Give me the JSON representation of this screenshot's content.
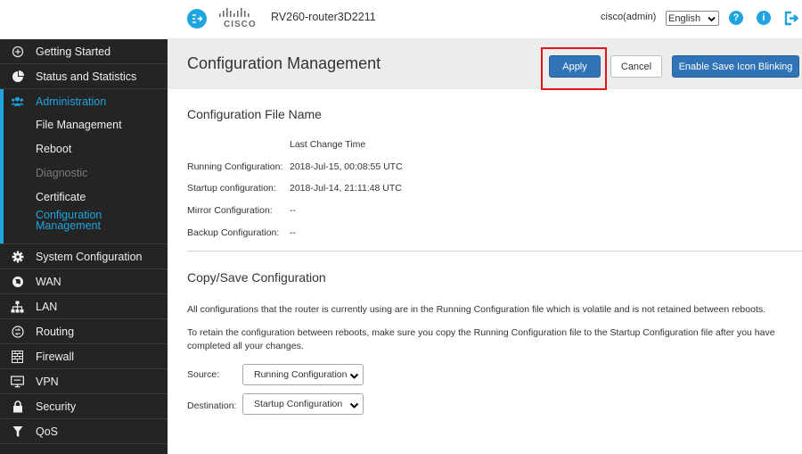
{
  "header": {
    "logo_text": "CISCO",
    "device_name": "RV260-router3D2211",
    "user": "cisco(admin)",
    "language": "English"
  },
  "sidebar": {
    "items": [
      {
        "label": "Getting Started",
        "icon": "wrench-icon"
      },
      {
        "label": "Status and Statistics",
        "icon": "pie-chart-icon"
      },
      {
        "label": "Administration",
        "icon": "users-icon"
      },
      {
        "label": "System Configuration",
        "icon": "gear-icon"
      },
      {
        "label": "WAN",
        "icon": "globe-icon"
      },
      {
        "label": "LAN",
        "icon": "network-icon"
      },
      {
        "label": "Routing",
        "icon": "routing-icon"
      },
      {
        "label": "Firewall",
        "icon": "firewall-icon"
      },
      {
        "label": "VPN",
        "icon": "monitor-icon"
      },
      {
        "label": "Security",
        "icon": "lock-icon"
      },
      {
        "label": "QoS",
        "icon": "filter-icon"
      }
    ],
    "admin_sub": [
      {
        "label": "File Management"
      },
      {
        "label": "Reboot"
      },
      {
        "label": "Diagnostic"
      },
      {
        "label": "Certificate"
      },
      {
        "label": "Configuration Management"
      }
    ]
  },
  "titlebar": {
    "title": "Configuration Management",
    "apply_label": "Apply",
    "cancel_label": "Cancel",
    "blink_label": "Enable Save Icon Blinking"
  },
  "config_file": {
    "title": "Configuration File Name",
    "column_header": "Last Change Time",
    "rows": [
      {
        "label": "Running Configuration:",
        "value": "2018-Jul-15, 00:08:55 UTC"
      },
      {
        "label": "Startup configuration:",
        "value": "2018-Jul-14, 21:11:48 UTC"
      },
      {
        "label": "Mirror Configuration:",
        "value": "--"
      },
      {
        "label": "Backup Configuration:",
        "value": "--"
      }
    ]
  },
  "copy_save": {
    "title": "Copy/Save Configuration",
    "para1": "All configurations that the router is currently using are in the Running Configuration file which is volatile and is not retained between reboots.",
    "para2": "To retain the configuration between reboots, make sure you copy the Running Configuration file to the Startup Configuration file after you have completed all your changes.",
    "source_label": "Source:",
    "source_value": "Running Configuration",
    "destination_label": "Destination:",
    "destination_value": "Startup Configuration"
  },
  "colors": {
    "accent": "#1fa4e0",
    "primary_button": "#3173b7",
    "sidebar_bg": "#242424",
    "highlight_box": "#e0141e"
  }
}
